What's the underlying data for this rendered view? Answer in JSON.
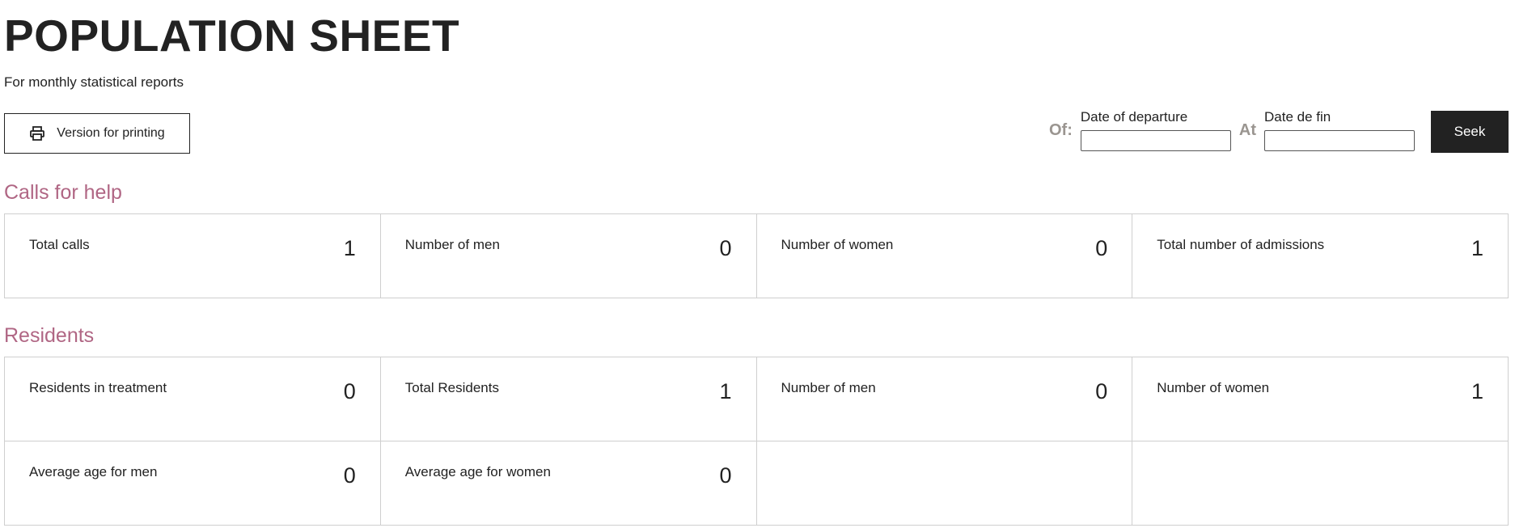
{
  "header": {
    "title": "POPULATION SHEET",
    "subtitle": "For monthly statistical reports"
  },
  "toolbar": {
    "print_icon": "printer-icon",
    "print_label": "Version for printing"
  },
  "filter": {
    "from_prefix": "Of:",
    "from_label": "Date of departure",
    "from_value": "",
    "to_prefix": "At",
    "to_label": "Date de fin",
    "to_value": "",
    "seek_label": "Seek"
  },
  "colors": {
    "accent": "#b06684",
    "dark": "#222222",
    "border": "#cfcfcf",
    "muted": "#9a9590"
  },
  "sections": [
    {
      "title": "Calls for help",
      "cells": [
        {
          "label": "Total calls",
          "value": "1"
        },
        {
          "label": "Number of men",
          "value": "0"
        },
        {
          "label": "Number of women",
          "value": "0"
        },
        {
          "label": "Total number of admissions",
          "value": "1"
        }
      ]
    },
    {
      "title": "Residents",
      "cells": [
        {
          "label": "Residents in treatment",
          "value": "0"
        },
        {
          "label": "Total Residents",
          "value": "1"
        },
        {
          "label": "Number of men",
          "value": "0"
        },
        {
          "label": "Number of women",
          "value": "1"
        },
        {
          "label": "Average age for men",
          "value": "0"
        },
        {
          "label": "Average age for women",
          "value": "0"
        },
        {
          "label": "",
          "value": ""
        },
        {
          "label": "",
          "value": ""
        }
      ]
    }
  ]
}
